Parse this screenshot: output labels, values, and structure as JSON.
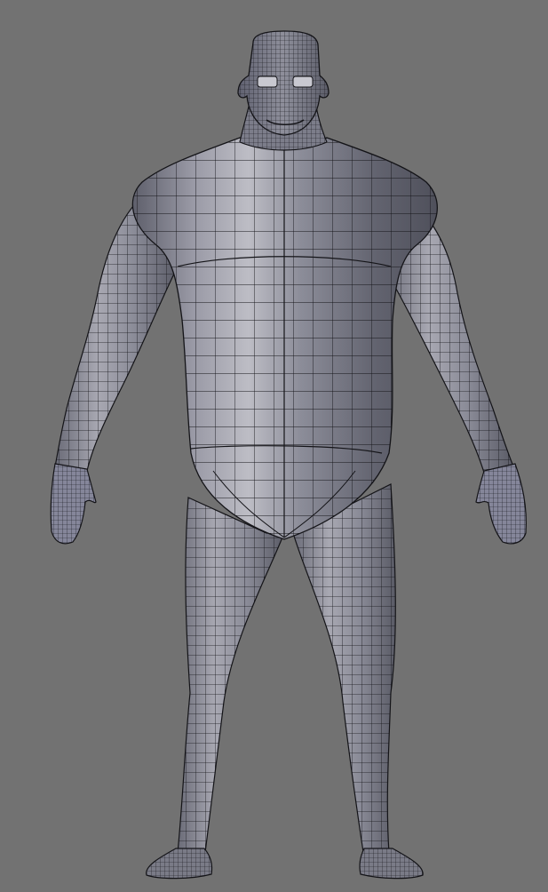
{
  "viewport": {
    "background_color": "#727272"
  },
  "model": {
    "subject": "humanoid-base-mesh",
    "display_mode": "shaded-wireframe",
    "surface_colors": {
      "base": "#8c8d99",
      "light": "#b8b8c0",
      "dark": "#54545e",
      "wire": "#141418"
    }
  }
}
